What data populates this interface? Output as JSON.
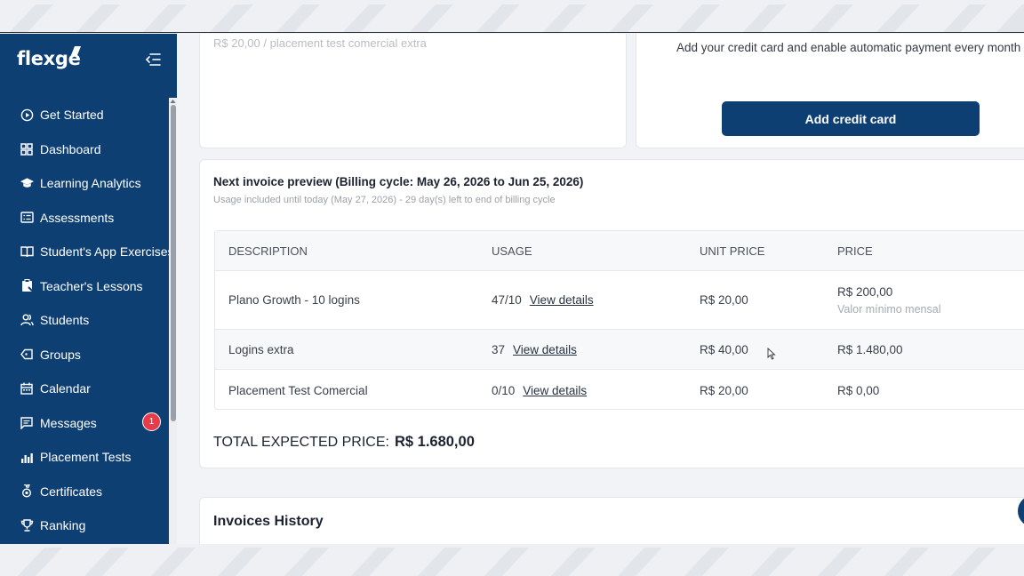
{
  "brand": {
    "logo_text": "flexge",
    "primary": "#0e3f73",
    "badge_color": "#e63b4b"
  },
  "sidebar": {
    "items": [
      {
        "label": "Get Started",
        "icon": "play-circle-icon"
      },
      {
        "label": "Dashboard",
        "icon": "grid-icon"
      },
      {
        "label": "Learning Analytics",
        "icon": "graduation-cap-icon"
      },
      {
        "label": "Assessments",
        "icon": "list-box-icon"
      },
      {
        "label": "Student's App Exercises",
        "icon": "book-icon"
      },
      {
        "label": "Teacher's Lessons",
        "icon": "clipboard-icon"
      },
      {
        "label": "Students",
        "icon": "users-icon"
      },
      {
        "label": "Groups",
        "icon": "tag-icon"
      },
      {
        "label": "Calendar",
        "icon": "calendar-icon"
      },
      {
        "label": "Messages",
        "icon": "message-icon",
        "badge": "1"
      },
      {
        "label": "Placement Tests",
        "icon": "bar-chart-icon"
      },
      {
        "label": "Certificates",
        "icon": "medal-icon"
      },
      {
        "label": "Ranking",
        "icon": "trophy-icon"
      }
    ]
  },
  "top_cards": {
    "placement_extra_text": "R$ 20,00 / placement test comercial extra",
    "credit_card_text": "Add your credit card and enable automatic payment every month",
    "add_credit_card_label": "Add credit card"
  },
  "invoice": {
    "title": "Next invoice preview (Billing cycle: May 26, 2026 to Jun 25, 2026)",
    "subtitle": "Usage included until today (May 27, 2026) - 29 day(s) left to end of billing cycle",
    "columns": [
      "DESCRIPTION",
      "USAGE",
      "UNIT PRICE",
      "PRICE"
    ],
    "rows": [
      {
        "description": "Plano Growth - 10 logins",
        "usage": "47/10",
        "link": "View details",
        "unit_price": "R$ 20,00",
        "price": "R$ 200,00",
        "price_note": "Valor mínimo mensal"
      },
      {
        "description": "Logins extra",
        "usage": "37",
        "link": "View details",
        "unit_price": "R$ 40,00",
        "price": "R$ 1.480,00"
      },
      {
        "description": "Placement Test Comercial",
        "usage": "0/10",
        "link": "View details",
        "unit_price": "R$ 20,00",
        "price": "R$ 0,00"
      }
    ],
    "total_label": "TOTAL EXPECTED PRICE:",
    "total_value": "R$ 1.680,00"
  },
  "history": {
    "title": "Invoices History"
  }
}
